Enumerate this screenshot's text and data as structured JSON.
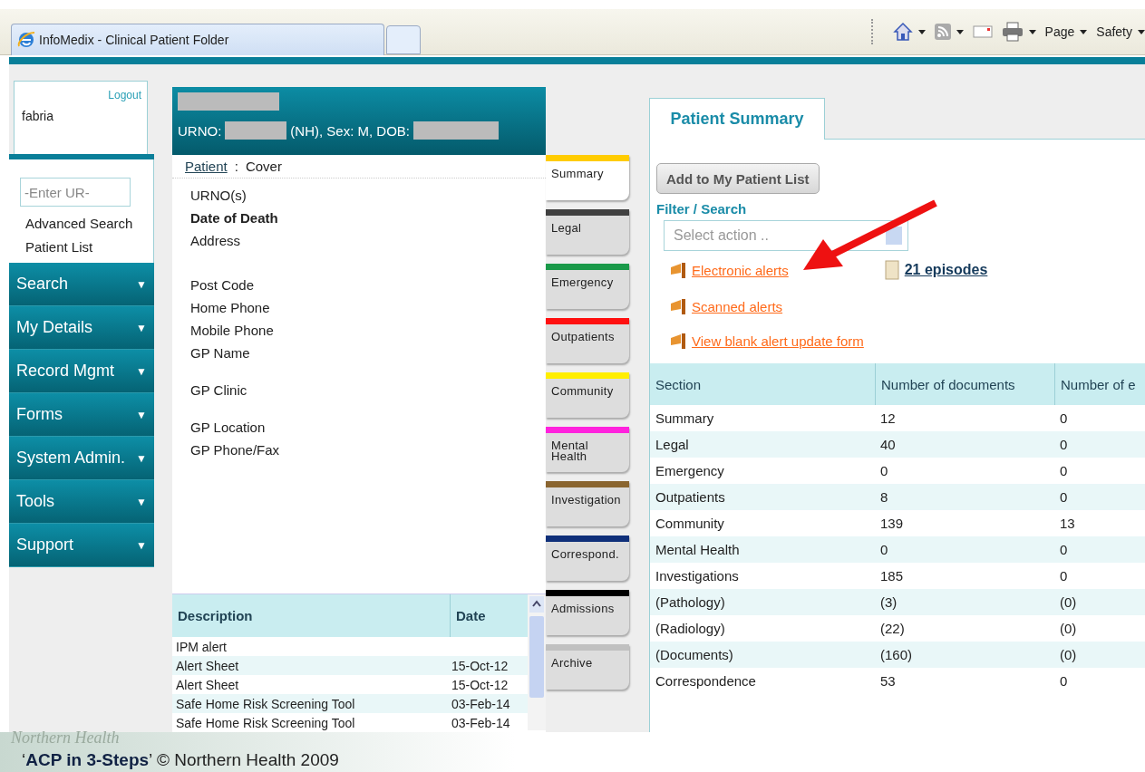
{
  "browser": {
    "tab_title": "InfoMedix - Clinical Patient Folder",
    "toolbar": [
      "Page",
      "Safety"
    ]
  },
  "user": {
    "logout": "Logout",
    "name": "fabria"
  },
  "search": {
    "placeholder": "-Enter UR-",
    "links": [
      "Advanced Search",
      "Patient List"
    ]
  },
  "menu": [
    {
      "label": "Search",
      "caret": "▼"
    },
    {
      "label": "My Details",
      "caret": "▼"
    },
    {
      "label": "Record Mgmt",
      "caret": "▼"
    },
    {
      "label": "Forms",
      "caret": "▼"
    },
    {
      "label": "System Admin.",
      "caret": "▼"
    },
    {
      "label": "Tools",
      "caret": "▼"
    },
    {
      "label": "Support",
      "caret": "▼"
    }
  ],
  "patient": {
    "urno_label": "URNO:",
    "details": "(NH), Sex: M, DOB:",
    "breadcrumb_link": "Patient",
    "breadcrumb_sep": ":",
    "breadcrumb_page": "Cover",
    "field_groups": [
      [
        {
          "label": "URNO(s)",
          "bold": false
        },
        {
          "label": "Date of Death",
          "bold": true
        },
        {
          "label": "Address",
          "bold": false
        }
      ],
      [
        {
          "label": "Post Code",
          "bold": false
        },
        {
          "label": "Home Phone",
          "bold": false
        },
        {
          "label": "Mobile Phone",
          "bold": false
        },
        {
          "label": "GP Name",
          "bold": false
        }
      ],
      [
        {
          "label": "GP Clinic",
          "bold": false
        }
      ],
      [
        {
          "label": "GP Location",
          "bold": false
        },
        {
          "label": "GP Phone/Fax",
          "bold": false
        }
      ]
    ],
    "documents": {
      "columns": [
        "Description",
        "Date"
      ],
      "rows": [
        {
          "description": "IPM alert"
        },
        {
          "description": "Alert Sheet",
          "date": "15-Oct-12"
        },
        {
          "description": "Alert Sheet",
          "date": "15-Oct-12"
        },
        {
          "description": "Safe Home Risk Screening Tool",
          "date": "03-Feb-14"
        },
        {
          "description": "Safe Home Risk Screening Tool",
          "date": "03-Feb-14"
        }
      ]
    }
  },
  "section_tabs": [
    {
      "label": "Summary",
      "color": "#ffcc00",
      "selected": true
    },
    {
      "label": "Legal",
      "color": "#404040",
      "selected": false
    },
    {
      "label": "Emergency",
      "color": "#1a9a4a",
      "selected": false
    },
    {
      "label": "Outpatients",
      "color": "#ff1010",
      "selected": false
    },
    {
      "label": "Community",
      "color": "#ffee00",
      "selected": false
    },
    {
      "label": "Mental Health",
      "color": "#ff22dd",
      "selected": false
    },
    {
      "label": "Investigation",
      "color": "#8a6530",
      "selected": false
    },
    {
      "label": "Correspond.",
      "color": "#10307a",
      "selected": false
    },
    {
      "label": "Admissions",
      "color": "#000000",
      "selected": false
    },
    {
      "label": "Archive",
      "color": "#c0c0c0",
      "selected": false
    }
  ],
  "summary": {
    "tab": "Patient Summary",
    "add_button": "Add to My Patient List",
    "filter_label": "Filter / Search",
    "select_placeholder": "Select action ..",
    "alert_links": [
      "Electronic alerts",
      "Scanned alerts",
      "View blank alert update form"
    ],
    "episodes_link": "21 episodes",
    "table": {
      "columns": [
        "Section",
        "Number of documents",
        "Number of e"
      ],
      "rows": [
        [
          "Summary",
          "12",
          "0"
        ],
        [
          "Legal",
          "40",
          "0"
        ],
        [
          "Emergency",
          "0",
          "0"
        ],
        [
          "Outpatients",
          "8",
          "0"
        ],
        [
          "Community",
          "139",
          "13"
        ],
        [
          "Mental Health",
          "0",
          "0"
        ],
        [
          "Investigations",
          "185",
          "0"
        ],
        [
          "(Pathology)",
          "(3)",
          "(0)"
        ],
        [
          "(Radiology)",
          "(22)",
          "(0)"
        ],
        [
          "(Documents)",
          "(160)",
          "(0)"
        ],
        [
          "Correspondence",
          "53",
          "0"
        ]
      ]
    }
  },
  "footer": {
    "logo_text": "Northern Health",
    "caption": "‘**ACP in 3-Steps**’ © Northern Health 2009"
  }
}
